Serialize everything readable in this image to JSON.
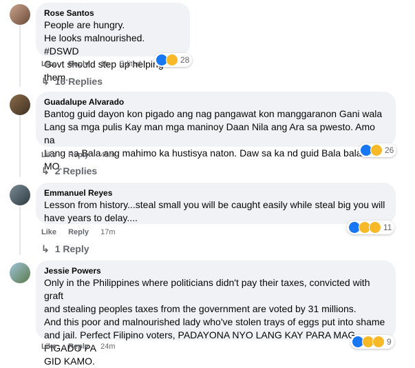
{
  "comments": [
    {
      "name": "Rose Santos",
      "lines": [
        "People are hungry.",
        "He looks malnourished. #DSWD",
        "Govt should step up helping them."
      ],
      "like": "Like",
      "reply": "Reply",
      "time": "1h",
      "edited": "Edited",
      "reactions": [
        "like-icon",
        "haha-icon"
      ],
      "reaction_count": "28",
      "replies": "16 Replies"
    },
    {
      "name": "Guadalupe Alvarado",
      "lines": [
        "Bantog guid dayon kon pigado ang nag pangawat kon manggaranon Gani wala",
        "Lang sa mga pulis Kay man mga maninoy Daan Nila ang Ara sa pwesto. Amo na",
        "Lang na Bala ang mahimo ka hustisya naton. Daw sa ka nd guid Bala balanse MO."
      ],
      "like": "Like",
      "reply": "Reply",
      "time": "49m",
      "reactions": [
        "like-icon",
        "sad-icon"
      ],
      "reaction_count": "26",
      "replies": "2 Replies"
    },
    {
      "name": "Emmanuel Reyes",
      "lines": [
        "Lesson from history...steal small you will be caught easily while steal big you will",
        "have years to delay...."
      ],
      "like": "Like",
      "reply": "Reply",
      "time": "17m",
      "reactions": [
        "like-icon",
        "sad-icon",
        "haha-icon"
      ],
      "reaction_count": "11",
      "replies": "1 Reply"
    },
    {
      "name": "Jessie Powers",
      "lines": [
        "Only in the Philippines where politicians didn't pay their taxes, convicted with graft",
        "and stealing peoples taxes from the government are voted by 31 millions.",
        "And this poor and malnourished lady who've stolen trays of eggs put into shame",
        "and jail. Perfect Filipino voters, PADAYONA NYO LANG KAY PARA MAG PIGADO PA",
        "GID KAMO."
      ],
      "like": "Like",
      "reply": "Reply",
      "time": "24m",
      "reactions": [
        "like-icon",
        "sad-icon",
        "haha-icon"
      ],
      "reaction_count": "9"
    }
  ],
  "colors": {
    "bubble": "#f0f2f5",
    "meta": "#65676b",
    "like_blue": "#1877f2",
    "emoji_yellow": "#f7b928"
  }
}
